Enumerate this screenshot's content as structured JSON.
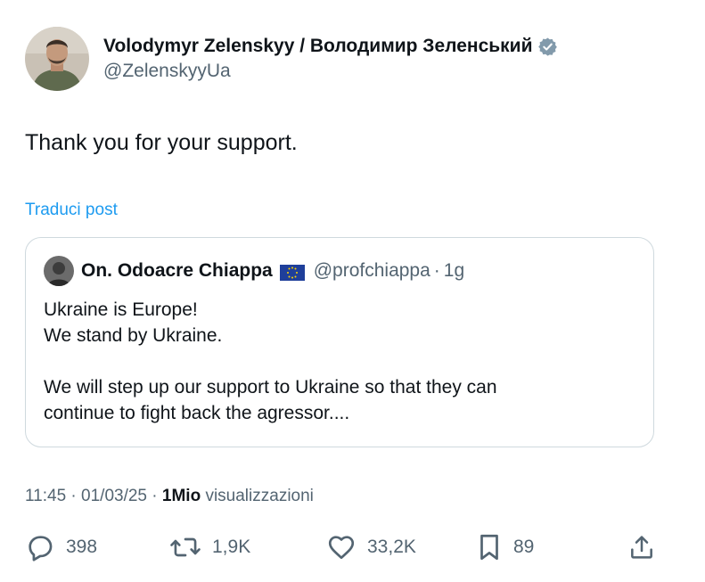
{
  "author": {
    "name": "Volodymyr Zelenskyy / Володимир Зеленський",
    "handle": "@ZelenskyyUa",
    "verified_icon": "verified-badge-icon",
    "verified_color": "#829aab"
  },
  "post": {
    "text": "Thank you for your support.",
    "translate_label": "Traduci post"
  },
  "quoted_post": {
    "name": "On. Odoacre Chiappa",
    "flag_icon": "eu-flag-icon",
    "handle": "@profchiappa",
    "separator": "·",
    "time": "1g",
    "lines": [
      "Ukraine is Europe!",
      "We stand by Ukraine.",
      "",
      "We will step up our support to Ukraine so that they can",
      "continue to fight back the agressor...."
    ]
  },
  "meta": {
    "time": "11:45",
    "sep1": "·",
    "date": "01/03/25",
    "sep2": "·",
    "views_count": "1Mio",
    "views_label": "visualizzazioni"
  },
  "actions": {
    "reply": {
      "icon": "reply-icon",
      "count": "398"
    },
    "repost": {
      "icon": "repost-icon",
      "count": "1,9K"
    },
    "like": {
      "icon": "heart-icon",
      "count": "33,2K"
    },
    "bookmark": {
      "icon": "bookmark-icon",
      "count": "89"
    },
    "share": {
      "icon": "share-icon"
    }
  },
  "colors": {
    "text": "#0f1419",
    "secondary": "#536471",
    "link": "#1d9bf0",
    "border": "#cfd9de"
  }
}
